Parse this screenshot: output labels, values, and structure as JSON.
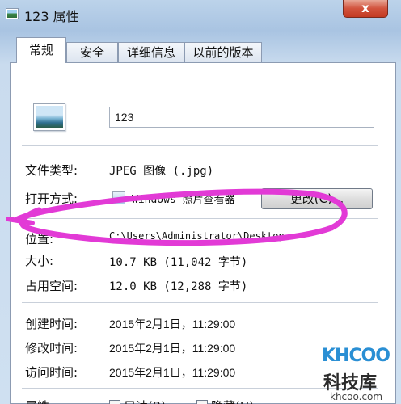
{
  "window": {
    "title": "123 属性",
    "close_glyph": "x"
  },
  "tabs": [
    {
      "label": "常规",
      "active": true
    },
    {
      "label": "安全",
      "active": false
    },
    {
      "label": "详细信息",
      "active": false
    },
    {
      "label": "以前的版本",
      "active": false
    }
  ],
  "file": {
    "name": "123",
    "icon": "image-file-icon"
  },
  "fields": {
    "type_label": "文件类型:",
    "type_value": "JPEG 图像 (.jpg)",
    "open_label": "打开方式:",
    "open_value": "Windows 照片查看器",
    "change_button": "更改(C)...",
    "location_label": "位置:",
    "location_value": "C:\\Users\\Administrator\\Desktop",
    "size_label": "大小:",
    "size_value": "10.7 KB (11,042 字节)",
    "disk_label": "占用空间:",
    "disk_value": "12.0 KB (12,288 字节)",
    "created_label": "创建时间:",
    "created_value": "2015年2月1日，11:29:00",
    "modified_label": "修改时间:",
    "modified_value": "2015年2月1日，11:29:00",
    "accessed_label": "访问时间:",
    "accessed_value": "2015年2月1日，11:29:00",
    "attr_label": "属性:",
    "readonly_label": "只读(R)",
    "hidden_label": "隐藏(H)"
  },
  "watermark": {
    "brand": "KHCOO",
    "name": "科技库",
    "url": "khcoo.com"
  },
  "colors": {
    "annotation": "#e23ad6",
    "titlebar": "#a9c4e2",
    "close": "#d2533d",
    "watermark_blue": "#2a8fd4"
  }
}
